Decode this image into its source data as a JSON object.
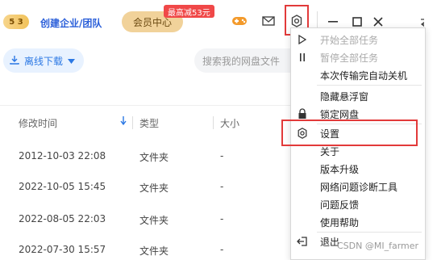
{
  "header": {
    "vip_level": "5 3",
    "create_label": "创建企业/团队",
    "vip_center_label": "会员中心",
    "promo_label": "最高减53元"
  },
  "toolbar": {
    "offline_label": "离线下载",
    "search_placeholder": "搜索我的网盘文件"
  },
  "table": {
    "headers": {
      "modified": "修改时间",
      "type": "类型",
      "size": "大小"
    },
    "rows": [
      {
        "modified": "2012-10-03 22:08",
        "type": "文件夹",
        "size": "-"
      },
      {
        "modified": "2022-10-05 15:45",
        "type": "文件夹",
        "size": "-"
      },
      {
        "modified": "2022-08-05 22:03",
        "type": "文件夹",
        "size": "-"
      },
      {
        "modified": "2022-07-30 15:57",
        "type": "文件夹",
        "size": "-"
      }
    ]
  },
  "menu": {
    "items": [
      {
        "label": "开始全部任务",
        "disabled": true
      },
      {
        "label": "暂停全部任务",
        "disabled": true
      },
      {
        "label": "本次传输完自动关机",
        "disabled": false
      },
      {
        "label": "隐藏悬浮窗",
        "disabled": false
      },
      {
        "label": "锁定网盘",
        "disabled": false
      },
      {
        "label": "设置",
        "disabled": false
      },
      {
        "label": "关于",
        "disabled": false
      },
      {
        "label": "版本升级",
        "disabled": false
      },
      {
        "label": "网络问题诊断工具",
        "disabled": false
      },
      {
        "label": "问题反馈",
        "disabled": false
      },
      {
        "label": "使用帮助",
        "disabled": false
      },
      {
        "label": "退出",
        "disabled": false
      }
    ]
  },
  "watermark": "CSDN @MI_farmer",
  "colors": {
    "accent": "#2b78e4",
    "highlight": "#e23a3a",
    "vip": "#f1d29a"
  }
}
